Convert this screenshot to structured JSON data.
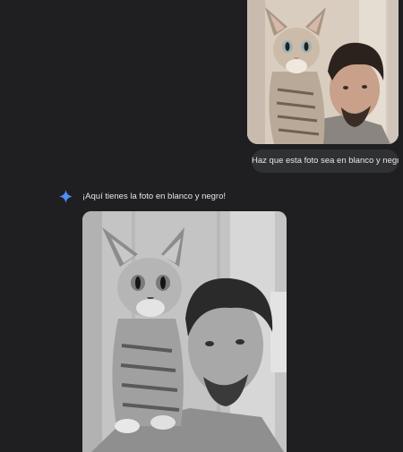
{
  "conversation": {
    "user_message": "Haz que esta foto sea en blanco y negro.",
    "assistant_reply": "¡Aquí tienes la foto en blanco y negro!",
    "assistant_icon": "gemini-sparkle-icon",
    "accent_color": "#4f8df7"
  }
}
